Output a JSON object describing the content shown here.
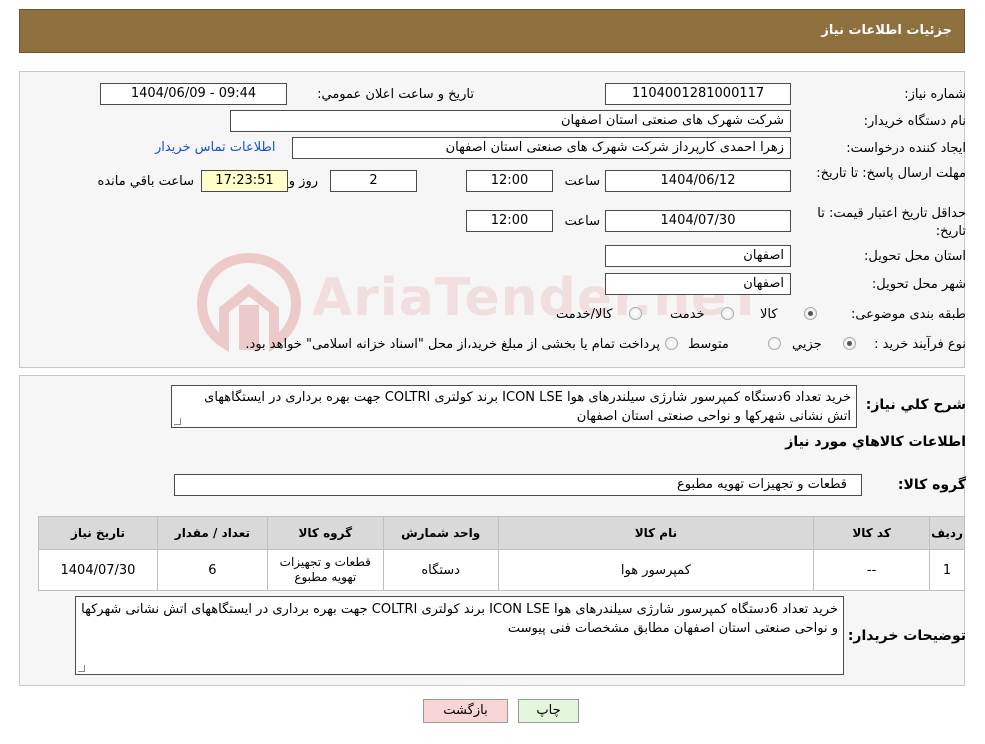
{
  "header": {
    "title": "جزئیات اطلاعات نیاز"
  },
  "labels": {
    "need_number": "شماره نیاز:",
    "announce_datetime": "تاریخ و ساعت اعلان عمومي:",
    "buyer_org": "نام دستگاه خريدار:",
    "requester": "ايجاد کننده درخواست:",
    "contact_link": "اطلاعات تماس خريدار",
    "reply_deadline": "مهلت ارسال پاسخ: تا تاريخ:",
    "time_word": "ساعت",
    "days_word": "روز و",
    "remaining_word": "ساعت باقي مانده",
    "price_validity": "حداقل تاريخ اعتبار قيمت: تا تاريخ:",
    "delivery_province": "استان محل تحويل:",
    "delivery_city": "شهر محل تحويل:",
    "category": "طبقه بندی موضوعی:",
    "process_type": "نوع فرآيند خريد :",
    "description": "شرح کلي نياز:",
    "goods_info": "اطلاعات کالاهاي مورد نياز",
    "goods_group": "گروه کالا:",
    "buyer_notes": "توضيحات خريدار:"
  },
  "values": {
    "need_number": "1104001281000117",
    "announce_datetime": "1404/06/09 - 09:44",
    "buyer_org": "شرکت شهرک هاى صنعتى استان اصفهان",
    "requester": "زهرا احمدی کارپرداز شرکت شهرک هاى صنعتى استان اصفهان",
    "reply_date": "1404/06/12",
    "reply_time": "12:00",
    "days": "2",
    "remaining": "17:23:51",
    "validity_date": "1404/07/30",
    "validity_time": "12:00",
    "delivery_province": "اصفهان",
    "delivery_city": "اصفهان",
    "description": "خرید تعداد 6دستگاه کمپرسور شارژی سیلندرهای هوا ICON LSE برند کولتری COLTRI جهت بهره برداری در ایستگاههای اتش نشانی شهرکها و نواحی صنعتی استان اصفهان",
    "goods_group": "قطعات و تجهیزات تهویه مطبوع",
    "buyer_notes": "خرید تعداد 6دستگاه کمپرسور شارژی سیلندرهای هوا ICON LSE برند کولتری COLTRI جهت بهره برداری در ایستگاههای اتش نشانی شهرکها و نواحی صنعتی استان اصفهان مطابق مشخصات فنی پیوست"
  },
  "category_options": [
    {
      "label": "کالا",
      "selected": true
    },
    {
      "label": "خدمت",
      "selected": false
    },
    {
      "label": "کالا/خدمت",
      "selected": false
    }
  ],
  "process_options": [
    {
      "label": "جزيي",
      "selected": true
    },
    {
      "label": "متوسط",
      "selected": false
    }
  ],
  "process_note": "پرداخت تمام يا بخشی از مبلغ خريد،از محل \"اسناد خزانه اسلامی\" خواهد بود.",
  "watermark": {
    "text": "AriaTender.neT",
    "color": "#e9b8b8"
  },
  "table": {
    "headers": [
      "رديف",
      "کد کالا",
      "نام کالا",
      "واحد شمارش",
      "گروه کالا",
      "تعداد / مقدار",
      "تاريخ نياز"
    ],
    "rows": [
      [
        "1",
        "--",
        "کمپرسور هوا",
        "دستگاه",
        "قطعات و تجهیزات تهویه مطبوع",
        "6",
        "1404/07/30"
      ]
    ]
  },
  "buttons": {
    "print": "چاپ",
    "back": "بازگشت"
  },
  "colors": {
    "header_bg": "#8e6f3e",
    "back_btn": "#f8d6d6",
    "print_btn": "#e4f7dc",
    "link": "#1a4fd0"
  }
}
